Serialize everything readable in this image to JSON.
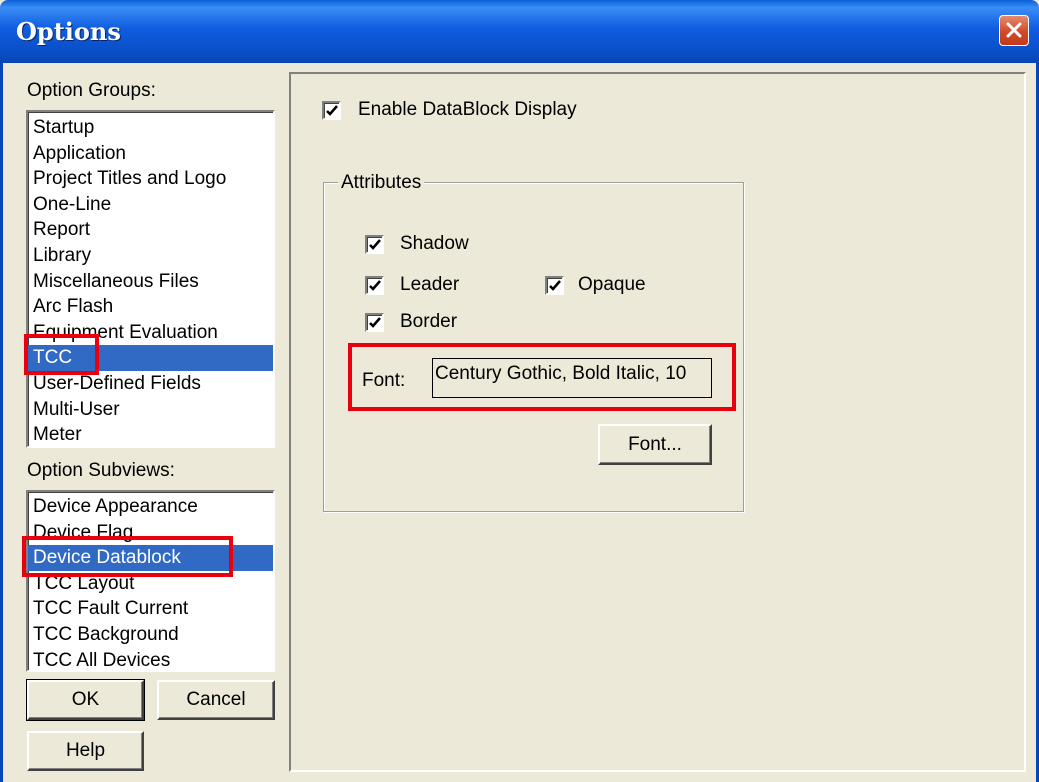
{
  "window": {
    "title": "Options"
  },
  "option_groups": {
    "label": "Option Groups:",
    "items": [
      "Startup",
      "Application",
      "Project Titles and Logo",
      "One-Line",
      "Report",
      "Library",
      "Miscellaneous Files",
      "Arc Flash",
      "Equipment Evaluation",
      "TCC",
      "User-Defined Fields",
      "Multi-User",
      "Meter"
    ],
    "selected": "TCC"
  },
  "option_subviews": {
    "label": "Option Subviews:",
    "items": [
      "Device Appearance",
      "Device Flag",
      "Device Datablock",
      "TCC Layout",
      "TCC Fault Current",
      "TCC Background",
      "TCC All Devices"
    ],
    "selected": "Device Datablock"
  },
  "buttons": {
    "ok": "OK",
    "cancel": "Cancel",
    "help": "Help",
    "font": "Font..."
  },
  "datablock": {
    "enable_label": "Enable DataBlock Display",
    "enable_checked": true,
    "attributes_title": "Attributes",
    "shadow_label": "Shadow",
    "shadow_checked": true,
    "leader_label": "Leader",
    "leader_checked": true,
    "opaque_label": "Opaque",
    "opaque_checked": true,
    "border_label": "Border",
    "border_checked": true,
    "font_label": "Font:",
    "font_value": "Century Gothic, Bold Italic, 10"
  },
  "colors": {
    "selection": "#316ac5",
    "highlight": "#e8000e",
    "title_bar": "#0a5fd6"
  }
}
